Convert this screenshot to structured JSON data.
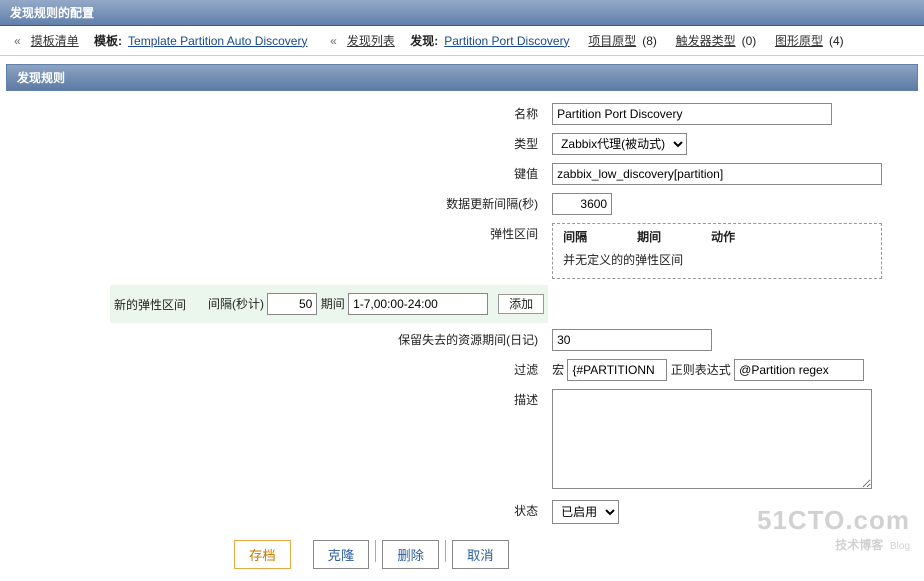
{
  "header": {
    "title": "发现规则的配置"
  },
  "nav": {
    "laquo1": "«",
    "templist": "摸板清单",
    "tpl_label": "模板:",
    "tpl_link": "Template Partition Auto Discovery",
    "laquo2": "«",
    "disc_list": "发现列表",
    "disc_label": "发现:",
    "disc_link": "Partition Port Discovery",
    "item_proto": "项目原型",
    "item_proto_count": "(8)",
    "trigger_proto": "触发器类型",
    "trigger_proto_count": "(0)",
    "graph_proto": "图形原型",
    "graph_proto_count": "(4)"
  },
  "section": {
    "title": "发现规则"
  },
  "form": {
    "name_label": "名称",
    "name_value": "Partition Port Discovery",
    "type_label": "类型",
    "type_value": "Zabbix代理(被动式)",
    "key_label": "键值",
    "key_value": "zabbix_low_discovery[partition]",
    "update_label": "数据更新间隔(秒)",
    "update_value": "3600",
    "flex_label": "弹性区间",
    "flex_hdr1": "间隔",
    "flex_hdr2": "期间",
    "flex_hdr3": "动作",
    "flex_empty": "并无定义的的弹性区间",
    "newflex_label": "新的弹性区间",
    "newflex_int_label": "间隔(秒计)",
    "newflex_int_value": "50",
    "newflex_period_label": "期间",
    "newflex_period_value": "1-7,00:00-24:00",
    "newflex_add": "添加",
    "keep_label": "保留失去的资源期间(日记)",
    "keep_value": "30",
    "filter_label": "过滤",
    "macro_label": "宏",
    "macro_value": "{#PARTITIONN",
    "regex_label": "正则表达式",
    "regex_value": "@Partition regex",
    "desc_label": "描述",
    "desc_value": "",
    "status_label": "状态",
    "status_value": "已启用"
  },
  "buttons": {
    "save": "存档",
    "clone": "克隆",
    "delete": "删除",
    "cancel": "取消"
  },
  "watermark": {
    "big": "51CTO.com",
    "small": "技术博客",
    "blog": "Blog"
  }
}
